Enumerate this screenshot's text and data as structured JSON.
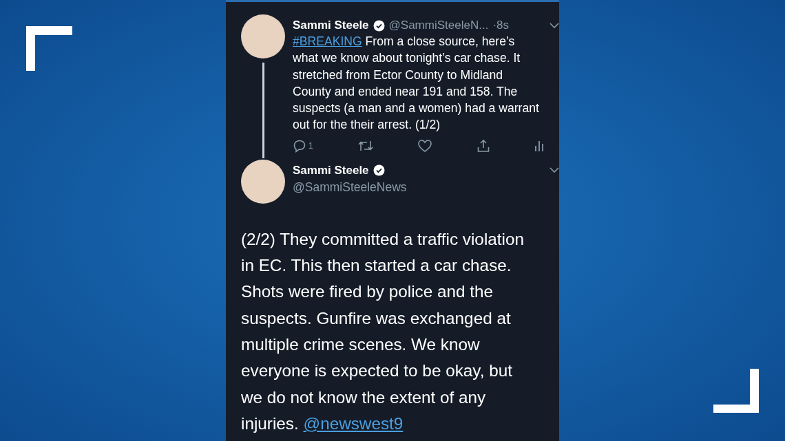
{
  "tweets": [
    {
      "author": "Sammi Steele",
      "verified": true,
      "handle": "@SammiSteeleN...",
      "time": "·8s",
      "hashtag": "#BREAKING",
      "text": "From a close source, here’s what we know about tonight’s car chase. It stretched from Ector County to Midland County and ended near 191 and 158. The suspects (a man and a women) had a warrant out for the their arrest. (1/2)",
      "threaded": true,
      "actions": [
        {
          "kind": "reply",
          "count": "1"
        },
        {
          "kind": "retweet"
        },
        {
          "kind": "like"
        },
        {
          "kind": "share"
        },
        {
          "kind": "analytics"
        }
      ]
    },
    {
      "author": "Sammi Steele",
      "verified": true,
      "handle": "@SammiSteeleNews",
      "text": "(2/2) They committed a traffic violation in EC. This then started a car chase. Shots were fired by police and the suspects. Gunfire was exchanged at multiple crime scenes. We know everyone is expected to be okay, but we do not know the extent of any injuries.",
      "mention": "@newswest9"
    }
  ]
}
